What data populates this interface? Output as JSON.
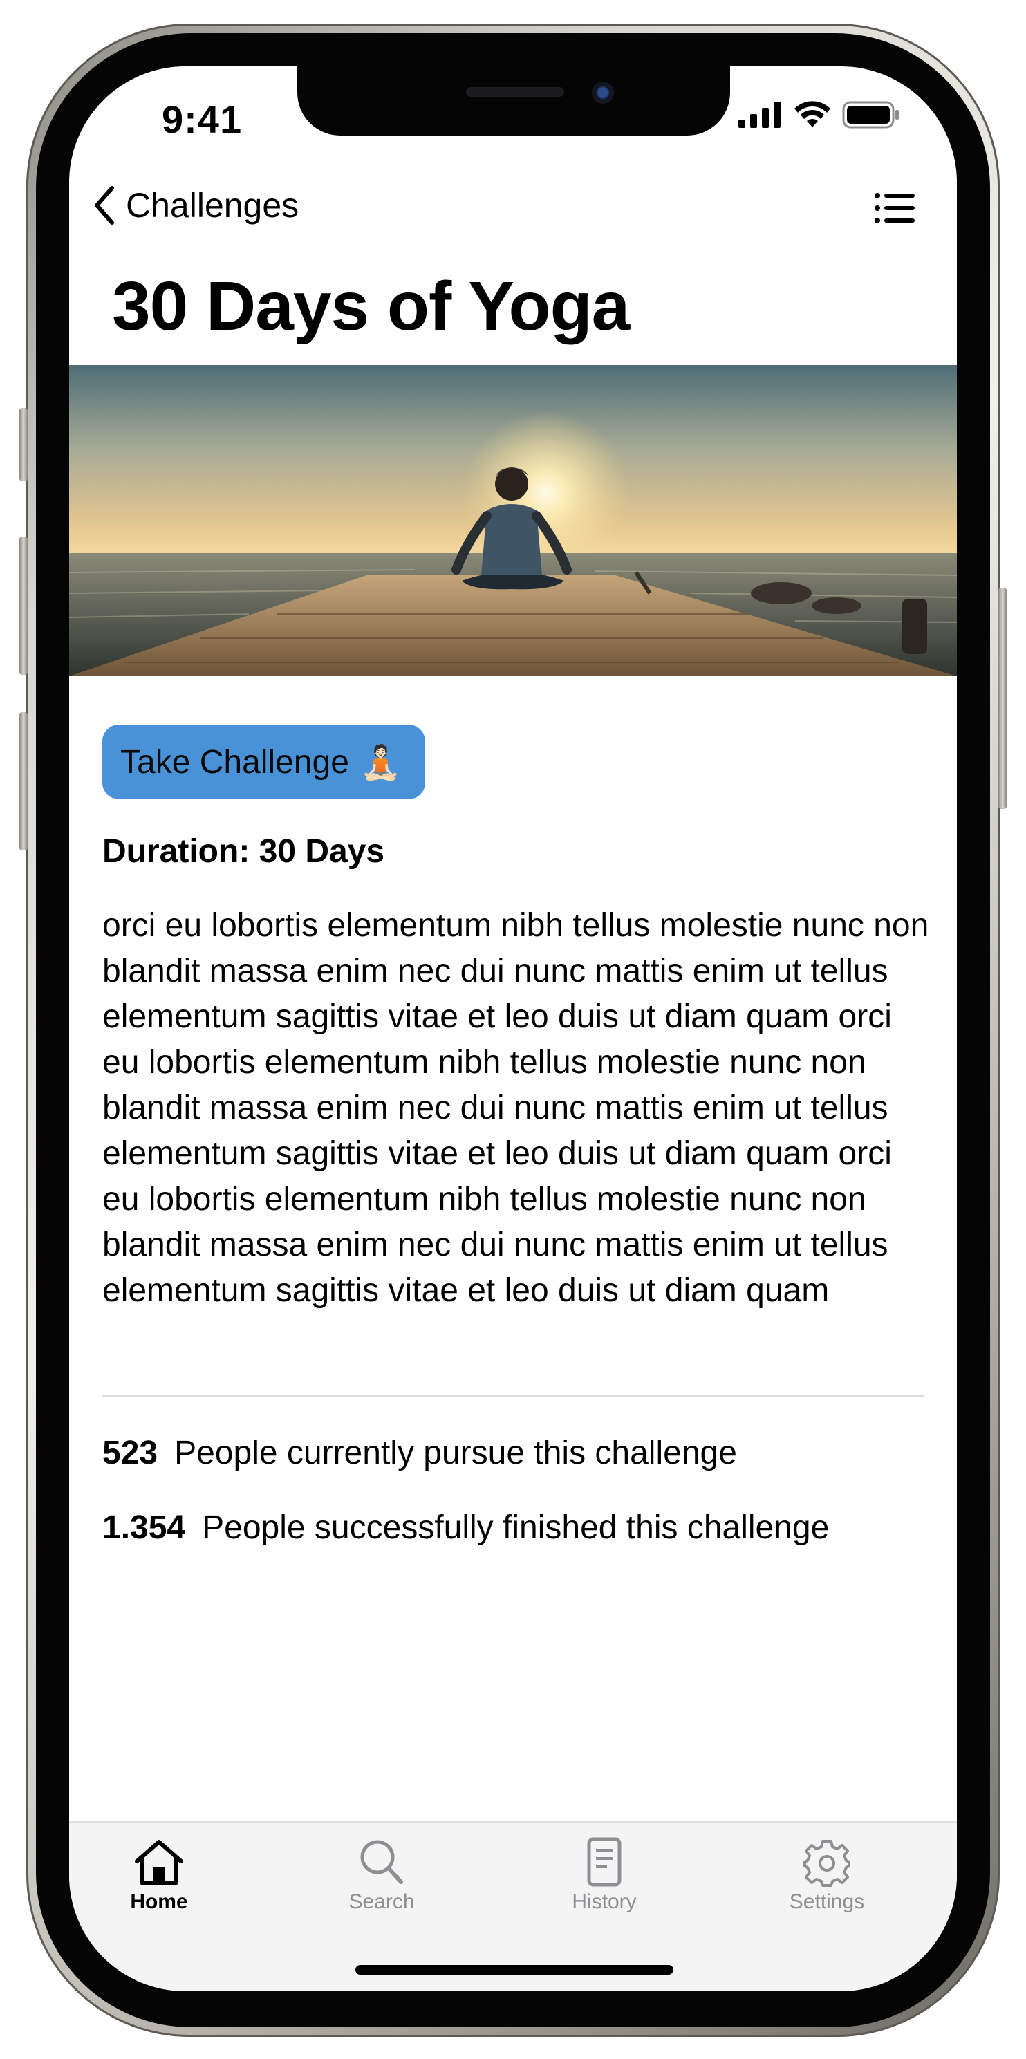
{
  "status_bar": {
    "time": "9:41"
  },
  "nav": {
    "back_label": "Challenges"
  },
  "page": {
    "title": "30 Days of Yoga"
  },
  "challenge": {
    "cta_label": "Take Challenge",
    "cta_emoji": "🧘🏻",
    "duration": "Duration: 30 Days",
    "description": "orci eu lobortis elementum nibh tellus molestie nunc non blandit massa enim nec dui nunc mattis enim ut tellus elementum sagittis vitae et leo duis ut diam quam orci eu lobortis elementum nibh tellus molestie nunc non blandit massa enim nec dui nunc mattis enim ut tellus elementum sagittis vitae et leo duis ut diam quam orci eu lobortis elementum nibh tellus molestie nunc non blandit massa enim nec dui nunc mattis enim ut tellus elementum sagittis vitae et leo duis ut diam quam"
  },
  "stats": [
    {
      "count": "523",
      "label": "People currently pursue this challenge"
    },
    {
      "count": "1.354",
      "label": "People successfully finished this challenge"
    }
  ],
  "tabbar": {
    "items": [
      {
        "label": "Home",
        "icon": "house-icon",
        "active": true
      },
      {
        "label": "Search",
        "icon": "magnifier-icon",
        "active": false
      },
      {
        "label": "History",
        "icon": "document-icon",
        "active": false
      },
      {
        "label": "Settings",
        "icon": "gear-icon",
        "active": false
      }
    ]
  },
  "colors": {
    "cta_background": "#4a92d8",
    "tab_active": "#000000",
    "tab_inactive": "#8e8e93"
  }
}
